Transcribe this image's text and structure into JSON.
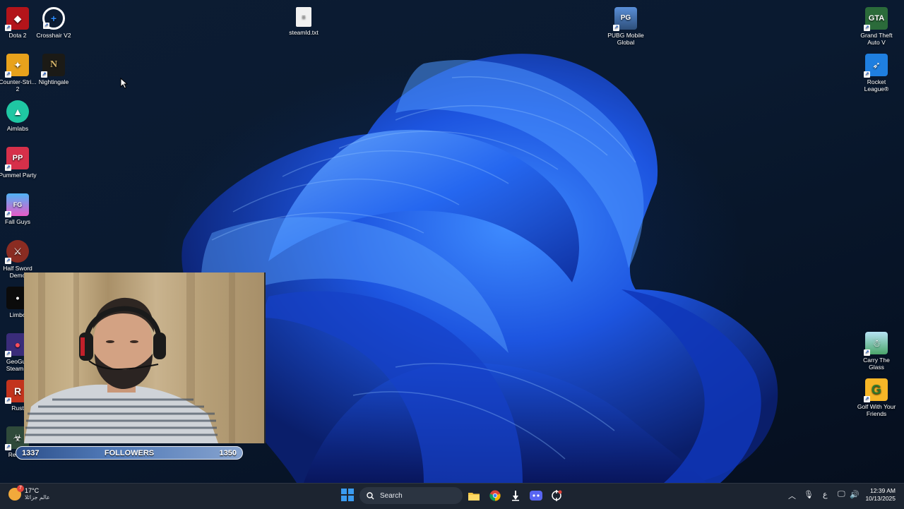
{
  "desktop_icons_left": [
    {
      "label": "Dota 2",
      "icon": "dota-icon"
    },
    {
      "label": "Crosshair V2",
      "icon": "crosshair-icon"
    },
    {
      "label": "Counter-Stri... 2",
      "icon": "counter-strike-icon"
    },
    {
      "label": "Nightingale",
      "icon": "nightingale-icon"
    },
    {
      "label": "Aimlabs",
      "icon": "aimlabs-icon"
    },
    {
      "label": "Pummel Party",
      "icon": "pummel-party-icon"
    },
    {
      "label": "Fall Guys",
      "icon": "fall-guys-icon"
    },
    {
      "label": "Half Sword Demo",
      "icon": "half-sword-icon"
    },
    {
      "label": "Limbo",
      "icon": "limbo-icon"
    },
    {
      "label": "GeoGue Steam E",
      "icon": "geoguessr-icon"
    },
    {
      "label": "Rust",
      "icon": "rust-icon"
    },
    {
      "label": "Reside",
      "icon": "resident-icon"
    }
  ],
  "desktop_icons_top": [
    {
      "label": "steamId.txt",
      "icon": "text-file-icon"
    },
    {
      "label": "PUBG Mobile Global",
      "icon": "pubg-icon"
    }
  ],
  "desktop_icons_right": [
    {
      "label": "Grand Theft Auto V",
      "icon": "gta-icon"
    },
    {
      "label": "Rocket League®",
      "icon": "rocket-league-icon"
    },
    {
      "label": "Carry The Glass",
      "icon": "carry-glass-icon"
    },
    {
      "label": "Golf With Your Friends",
      "icon": "golf-icon"
    }
  ],
  "followers_bar": {
    "current": "1337",
    "label": "FOLLOWERS",
    "goal": "1350",
    "progress": 0.99
  },
  "taskbar": {
    "weather_temp": "17°C",
    "weather_location": "عالم جزائلا",
    "weather_badge": "7",
    "search_placeholder": "Search",
    "pinned_apps": [
      {
        "icon": "file-explorer-icon"
      },
      {
        "icon": "chrome-icon"
      },
      {
        "icon": "steam-icon"
      },
      {
        "icon": "discord-icon"
      },
      {
        "icon": "crosshair-app-icon"
      }
    ],
    "tray_lang": "ع",
    "time": "12:39 AM",
    "date": "10/13/2025"
  },
  "colors": {
    "accent": "#3a9bf0",
    "taskbar": "#1c2430",
    "bloom": "#1e5fe6"
  }
}
